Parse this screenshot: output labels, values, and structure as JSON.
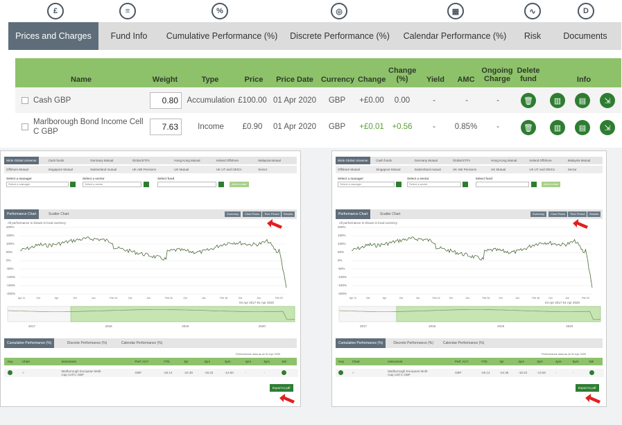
{
  "tabs": [
    {
      "label": "Prices and Charges",
      "icon": "pound-icon",
      "glyph": "£"
    },
    {
      "label": "Fund Info",
      "icon": "list-icon",
      "glyph": "≡"
    },
    {
      "label": "Cumulative Performance (%)",
      "icon": "percent-icon",
      "glyph": "%"
    },
    {
      "label": "Discrete Performance (%)",
      "icon": "target-icon",
      "glyph": "◎"
    },
    {
      "label": "Calendar Performance (%)",
      "icon": "calendar-icon",
      "glyph": "▦"
    },
    {
      "label": "Risk",
      "icon": "pulse-icon",
      "glyph": "∿"
    },
    {
      "label": "Documents",
      "icon": "document-icon",
      "glyph": "D"
    }
  ],
  "price_table": {
    "headers": {
      "name": "Name",
      "weight": "Weight",
      "type": "Type",
      "price": "Price",
      "price_date": "Price Date",
      "currency": "Currency",
      "change": "Change",
      "change_pct": "Change (%)",
      "yield": "Yield",
      "amc": "AMC",
      "ongoing": "Ongoing Charge",
      "delete": "Delete fund",
      "info": "Info"
    },
    "rows": [
      {
        "name": "Cash GBP",
        "weight": "0.80",
        "type": "Accumulation",
        "price": "£100.00",
        "price_date": "01 Apr 2020",
        "currency": "GBP",
        "change": "+£0.00",
        "change_pct": "0.00",
        "yield": "-",
        "amc": "-",
        "ongoing": "-"
      },
      {
        "name": "Marlborough Bond Income Cell C GBP",
        "weight": "7.63",
        "type": "Income",
        "price": "£0.90",
        "price_date": "01 Apr 2020",
        "currency": "GBP",
        "change": "+£0.01",
        "change_pct": "+0.56",
        "yield": "-",
        "amc": "0.85%",
        "ongoing": "-"
      }
    ]
  },
  "panel": {
    "sector_tabs_row1": [
      "Wide Global Universe",
      "Cash funds",
      "Germany Mutual",
      "Global ETFs",
      "Hong Kong Mutual",
      "Ireland Offshore",
      "Malaysia Mutual"
    ],
    "sector_tabs_row2": [
      "Offshore Mutual",
      "Singapore Mutual",
      "Switzerland mutual",
      "UK ABI Pensions",
      "UK Mutual",
      "UK UT and OEICs",
      "Sector"
    ],
    "select_manager_label": "Select a manager",
    "select_sector_label": "Select a sector",
    "select_fund_label": "Select fund",
    "select_manager_ph": "Select a manager",
    "select_sector_ph": "Select a sector",
    "add_button": "Add to chart",
    "chart_tabs": [
      "Performance Chart",
      "Scatter Chart"
    ],
    "chart_buttons": [
      "Summary",
      "Chart Rows",
      "Time Period",
      "Results"
    ],
    "currency_note": "All performance is shown in local currency",
    "y_ticks": [
      "200%",
      "150%",
      "100%",
      "50%",
      "0%",
      "-50%",
      "-100%",
      "-150%",
      "-200%"
    ],
    "x_ticks": [
      "Apr 11",
      "Jul",
      "Oct",
      "Jan",
      "Apr",
      "Jul",
      "Oct",
      "Feb 13",
      "Jun",
      "Oct",
      "Feb 14",
      "Jun",
      "Oct",
      "Feb 15",
      "Jun",
      "Oct",
      "Feb 16",
      "Jun",
      "Oct",
      "Feb 17",
      "Jun",
      "Oct",
      "Feb 18",
      "Jun",
      "Oct",
      "Feb 19",
      "Jun",
      "Oct",
      "Feb 20",
      "Apr"
    ],
    "date_range": "04 Apr 2017-01 Apr 2020",
    "nav_years": [
      "2017",
      "2018",
      "2019",
      "2020"
    ],
    "perf_tabs": [
      "Cumulative Performance (%)",
      "Discrete Performance (%)",
      "Calendar Performance (%)"
    ],
    "perf_note": "Performance data as at 01 Apr 2020",
    "perf_headers": [
      "Key",
      "Chart",
      "Instrument",
      "Perf. ACY",
      "YTD",
      "3yr",
      "2yrs",
      "3yrs",
      "4yrs",
      "5yrs",
      "Del"
    ],
    "perf_row": [
      "A",
      "✓",
      "Marlborough European Multi-Cap Cell C GBP",
      "GBP",
      "-25.14",
      "-22.38",
      "-18.23",
      "-13.50",
      "-",
      "-"
    ],
    "export_label": "Export to pdf"
  },
  "colors": {
    "green": "#8dc26a",
    "dark_green": "#2e7d32",
    "slate": "#5e6d79",
    "arrow": "#e02020"
  }
}
